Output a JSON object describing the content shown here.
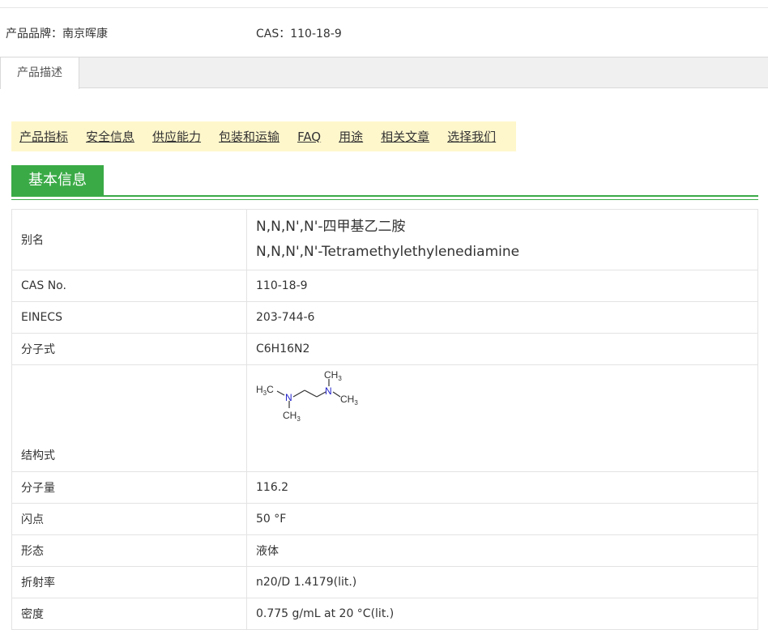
{
  "product_info": {
    "brand": "产品品牌：南京晖康",
    "cas": "CAS：110-18-9"
  },
  "tabs": [
    {
      "label": "产品描述",
      "active": true
    }
  ],
  "anchor_nav": [
    "产品指标",
    "安全信息",
    "供应能力",
    "包装和运输",
    "FAQ",
    "用途",
    "相关文章",
    "选择我们"
  ],
  "section": {
    "title": "基本信息"
  },
  "spec": {
    "alias": {
      "key": "别名",
      "value_cn": "N,N,N',N'-四甲基乙二胺",
      "value_en": "N,N,N',N'-Tetramethylethylenediamine"
    },
    "cas_no": {
      "key": "CAS No.",
      "value": "110-18-9"
    },
    "einecs": {
      "key": "EINECS",
      "value": "203-744-6"
    },
    "formula": {
      "key": "分子式",
      "value": "C6H16N2"
    },
    "structure": {
      "key": "结构式",
      "atoms": {
        "n": "N",
        "ch3": "CH",
        "h3c": "H",
        "three": "3",
        "c": "C"
      }
    },
    "mw": {
      "key": "分子量",
      "value": "116.2"
    },
    "flash": {
      "key": "闪点",
      "value": "50 °F"
    },
    "form": {
      "key": "形态",
      "value": "液体"
    },
    "refractive": {
      "key": "折射率",
      "value": "n20/D 1.4179(lit.)"
    },
    "density": {
      "key": "密度",
      "value": "0.775 g/mL at 20 °C(lit.)"
    }
  },
  "colors": {
    "green": "#3aaa46",
    "nav_bg": "#fff7cc",
    "nitrogen": "#2222cc"
  }
}
